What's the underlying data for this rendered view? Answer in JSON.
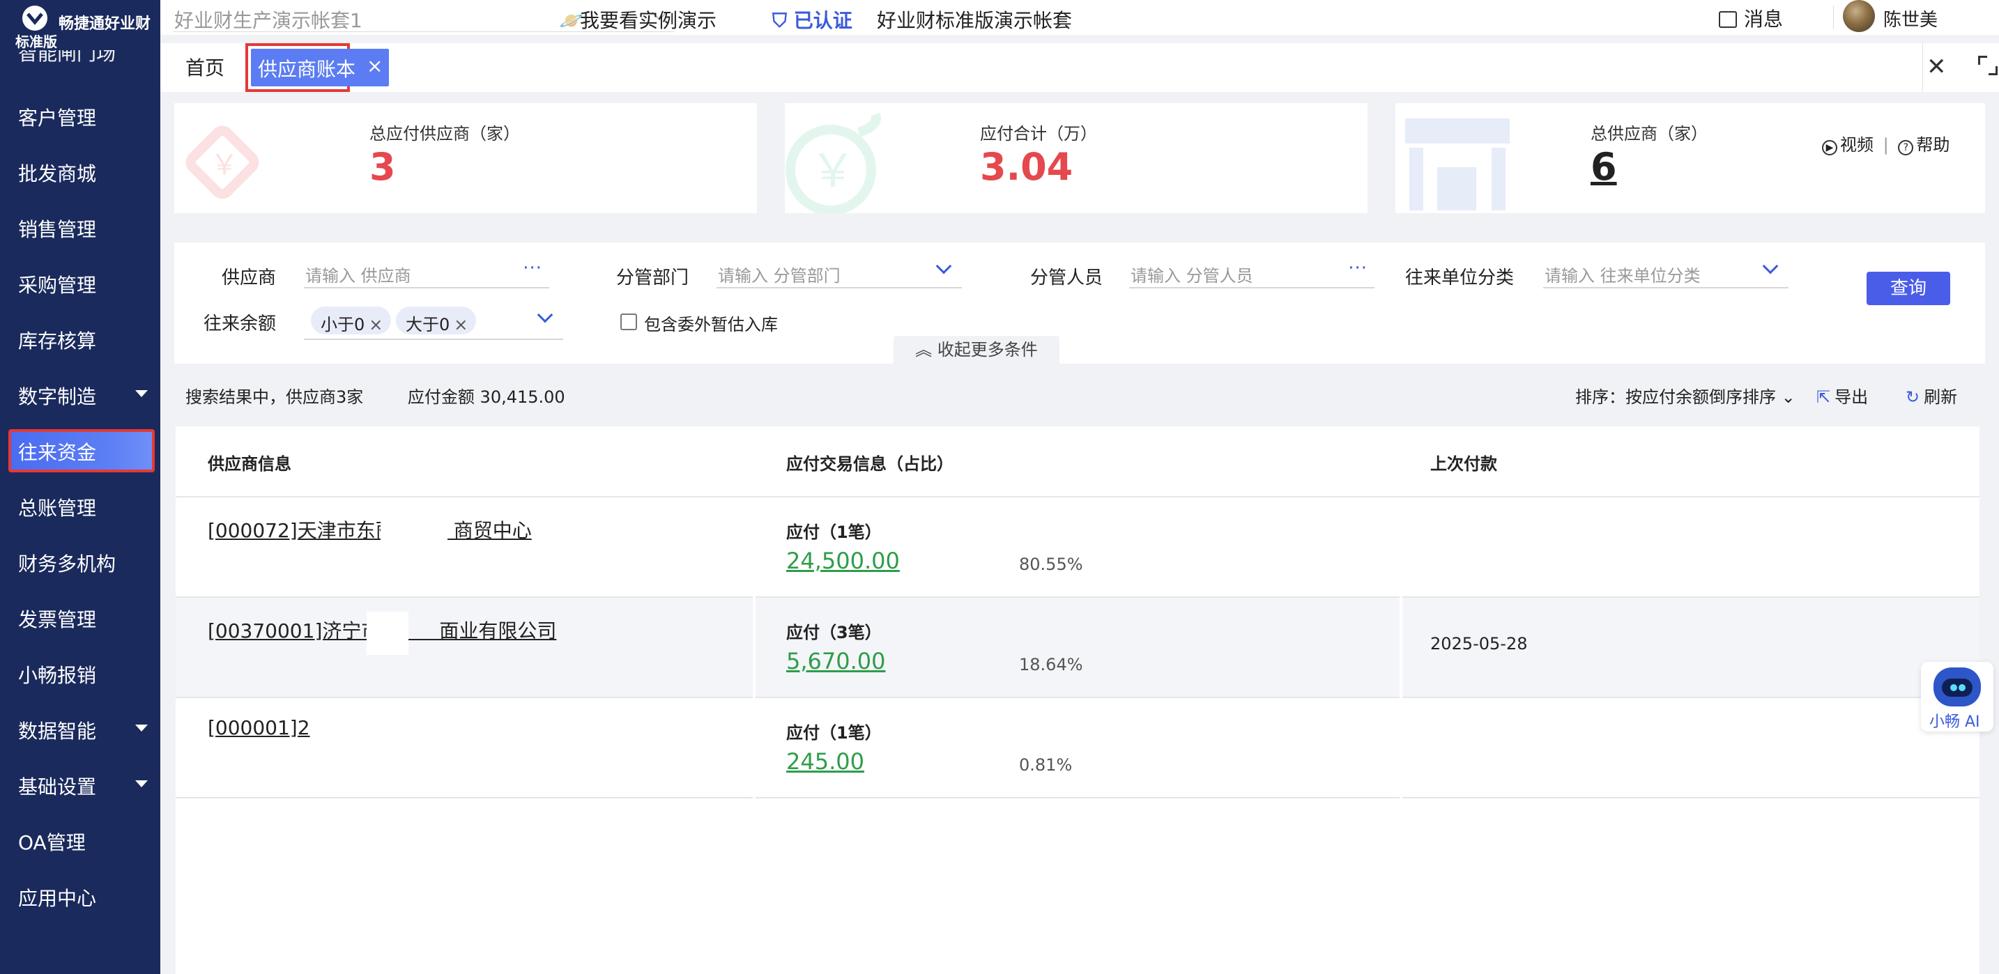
{
  "app": {
    "brand": "畅捷通好业财",
    "edition": "标准版"
  },
  "sidebar": {
    "partial_item": "智能闸门场",
    "items": [
      {
        "label": "客户管理",
        "has_caret": false
      },
      {
        "label": "批发商城",
        "has_caret": false
      },
      {
        "label": "销售管理",
        "has_caret": false
      },
      {
        "label": "采购管理",
        "has_caret": false
      },
      {
        "label": "库存核算",
        "has_caret": false
      },
      {
        "label": "数字制造",
        "has_caret": true
      },
      {
        "label": "往来资金",
        "has_caret": false,
        "active": true
      },
      {
        "label": "总账管理",
        "has_caret": false
      },
      {
        "label": "财务多机构",
        "has_caret": false
      },
      {
        "label": "发票管理",
        "has_caret": false
      },
      {
        "label": "小畅报销",
        "has_caret": false
      },
      {
        "label": "数据智能",
        "has_caret": true
      },
      {
        "label": "基础设置",
        "has_caret": true
      },
      {
        "label": "OA管理",
        "has_caret": false
      },
      {
        "label": "应用中心",
        "has_caret": false
      }
    ]
  },
  "topbar": {
    "account_select": "好业财生产演示帐套1",
    "demo_link": "我要看实例演示",
    "certified": "已认证",
    "account_name": "好业财标准版演示帐套",
    "messages": "消息",
    "user_name": "陈世美"
  },
  "tabs": {
    "home": "首页",
    "active": "供应商账本",
    "close": "×"
  },
  "stats": {
    "payable_suppliers_label": "总应付供应商（家）",
    "payable_suppliers_value": "3",
    "payable_total_label": "应付合计（万）",
    "payable_total_value": "3.04",
    "total_suppliers_label": "总供应商（家）",
    "total_suppliers_value": "6",
    "video": "视频",
    "help": "帮助",
    "colors": {
      "red": "#e5484d",
      "dark": "#222222"
    }
  },
  "filters": {
    "supplier_label": "供应商",
    "supplier_placeholder": "请输入 供应商",
    "dept_label": "分管部门",
    "dept_placeholder": "请输入 分管部门",
    "staff_label": "分管人员",
    "staff_placeholder": "请输入 分管人员",
    "category_label": "往来单位分类",
    "category_placeholder": "请输入 往来单位分类",
    "balance_label": "往来余额",
    "chips": [
      "小于0",
      "大于0"
    ],
    "include_outsourced": "包含委外暂估入库",
    "query_button": "查询",
    "collapse": "收起更多条件"
  },
  "summary": {
    "result_text": "搜索结果中，供应商3家",
    "amount_text": "应付金额 30,415.00",
    "sort_text": "排序：按应付余额倒序排序",
    "export": "导出",
    "refresh": "刷新"
  },
  "table": {
    "headers": {
      "supplier": "供应商信息",
      "payable": "应付交易信息（占比）",
      "last_payment": "上次付款"
    },
    "rows": [
      {
        "name": "[000072]天津市东丽　　　商贸中心",
        "pay_title": "应付（1笔）",
        "amount": "24,500.00",
        "percent": "80.55%",
        "last_payment": ""
      },
      {
        "name": "[00370001]济宁市　　　面业有限公司",
        "pay_title": "应付（3笔）",
        "amount": "5,670.00",
        "percent": "18.64%",
        "last_payment": "2025-05-28"
      },
      {
        "name": "[000001]2",
        "pay_title": "应付（1笔）",
        "amount": "245.00",
        "percent": "0.81%",
        "last_payment": ""
      }
    ]
  },
  "assistant": {
    "label": "小畅 AI"
  }
}
